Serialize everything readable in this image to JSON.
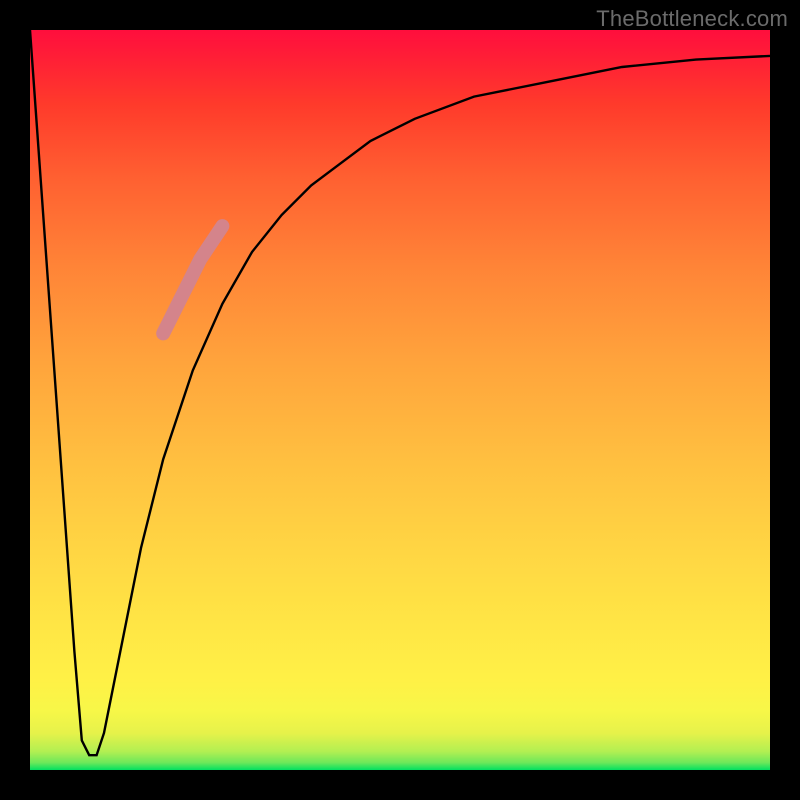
{
  "watermark": "TheBottleneck.com",
  "chart_data": {
    "type": "line",
    "title": "",
    "xlabel": "",
    "ylabel": "",
    "xlim": [
      0,
      100
    ],
    "ylim": [
      0,
      100
    ],
    "background": {
      "gradient": "green-yellow-red",
      "direction": "bottom-to-top"
    },
    "series": [
      {
        "name": "baseline-line",
        "style": "thin-black",
        "x": [
          0,
          1,
          2,
          3,
          4,
          5,
          6,
          7,
          8,
          9,
          10,
          11,
          13,
          15,
          18,
          22,
          26,
          30,
          34,
          38,
          42,
          46,
          52,
          60,
          70,
          80,
          90,
          100
        ],
        "values": [
          100,
          86,
          72,
          58,
          44,
          30,
          16,
          4,
          2,
          2,
          5,
          10,
          20,
          30,
          42,
          54,
          63,
          70,
          75,
          79,
          82,
          85,
          88,
          91,
          93,
          95,
          96,
          96.5
        ]
      },
      {
        "name": "highlight-segment",
        "style": "thick-pink",
        "x": [
          18,
          19,
          20,
          21,
          22,
          23,
          24,
          25,
          26
        ],
        "values": [
          59,
          61,
          63,
          65,
          67,
          69,
          70.5,
          72,
          73.5
        ]
      }
    ],
    "annotations": []
  }
}
